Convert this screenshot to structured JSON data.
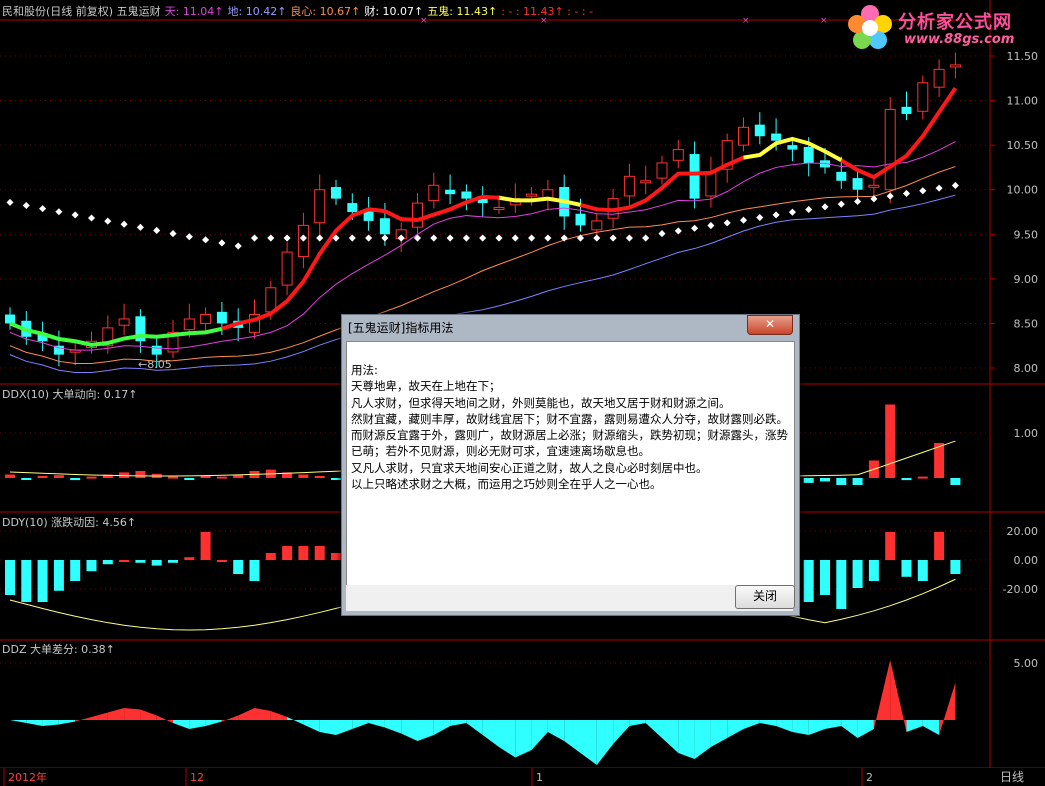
{
  "header": {
    "main": [
      {
        "text": "民和股份(日线 前复权) 五鬼运财",
        "color": "#c8c8c8"
      },
      {
        "text": "天: 11.04↑",
        "color": "#e040e0"
      },
      {
        "text": "地: 10.42↑",
        "color": "#9a9aff"
      },
      {
        "text": "良心: 10.67↑",
        "color": "#ff8c50"
      },
      {
        "text": "财: 10.07↑",
        "color": "#ffffff"
      },
      {
        "text": "五鬼: 11.43↑",
        "color": "#ffff50"
      },
      {
        "text": ": -  : 11.43↑ : -  : -",
        "color": "#ff3030"
      }
    ],
    "ddx": [
      {
        "text": "DDX(10) 大单动向: 0.17↑",
        "color": "#c8c8c8"
      }
    ],
    "ddy": [
      {
        "text": "DDY(10) 涨跌动因: 4.56↑",
        "color": "#c8c8c8"
      }
    ],
    "ddz": [
      {
        "text": "DDZ 大单差分: 0.38↑",
        "color": "#c8c8c8"
      }
    ]
  },
  "logo": {
    "title": "分析家公式网",
    "url": "www.88gs.com"
  },
  "axes": {
    "main_ticks": [
      "11.50",
      "11.00",
      "10.50",
      "10.00",
      "9.50",
      "9.00",
      "8.50",
      "8.00"
    ],
    "ddx_ticks": [
      "1.00"
    ],
    "ddy_ticks": [
      "20.00",
      "0.00",
      "-20.00"
    ],
    "ddz_ticks": [
      "5.00"
    ],
    "low_mark": "←8.05",
    "dates": [
      "2012年",
      "12",
      "1",
      "2"
    ],
    "period": "日线"
  },
  "dialog": {
    "title": "[五鬼运财]指标用法",
    "lines": [
      "用法:",
      "天尊地卑，故天在上地在下；",
      "凡人求财，但求得天地间之财，外则莫能也，故天地又居于财和财源之间。",
      "然财宜藏，藏则丰厚，故财线宜居下；财不宜露，露则易遭众人分夺，故财露则必跌。",
      "而财源反宜露于外，露则广，故财源居上必涨；财源缩头，跌势初现；财源露头，涨势已萌；若外不见财源，则必无财可求，宜速速离场歇息也。",
      "又凡人求财，只宜求天地间安心正道之财，故人之良心必时刻居中也。",
      "以上只略述求财之大概，而运用之巧妙则全在乎人之一心也。"
    ],
    "close_button": "关闭",
    "close_x": "✕"
  },
  "colors": {
    "up": "#ff3030",
    "down": "#30ffff",
    "grid": "#7a0000",
    "axis": "#b00000"
  }
}
